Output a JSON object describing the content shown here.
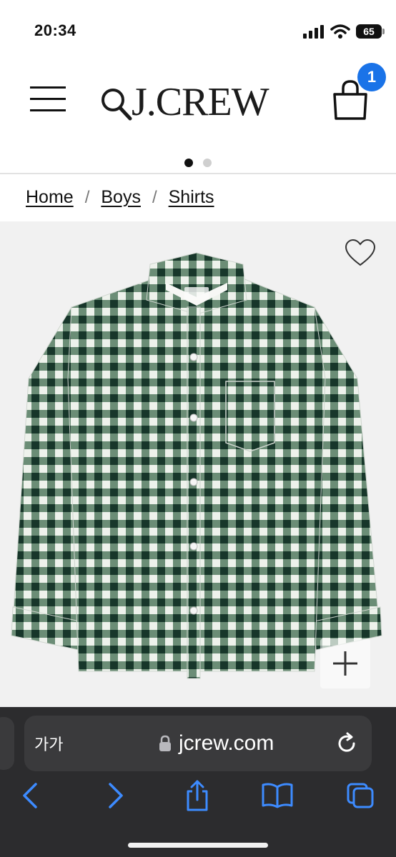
{
  "status": {
    "time": "20:34",
    "battery": "65"
  },
  "header": {
    "logo": "J.CREW",
    "bag_count": "1"
  },
  "carousel": {
    "total": 2,
    "active": 1
  },
  "breadcrumb": {
    "items": [
      "Home",
      "Boys",
      "Shirts"
    ],
    "separator": "/"
  },
  "product": {
    "image": "green-gingham-shirt-icon"
  },
  "browser": {
    "aa_label": "가가",
    "url": "jcrew.com",
    "colors": {
      "toolbar_bg": "#2c2c2e",
      "accent": "#3d8bff"
    }
  },
  "colors": {
    "badge": "#1a73e8"
  }
}
